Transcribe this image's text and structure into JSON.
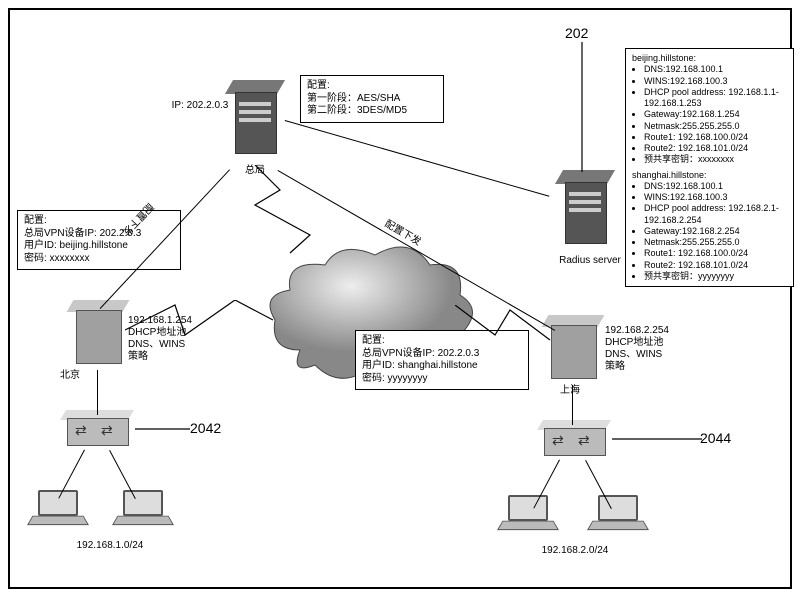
{
  "refs": {
    "r202": "202",
    "r2042": "2042",
    "r2044": "2044"
  },
  "hq": {
    "ip": "IP: 202.2.0.3",
    "name": "总局",
    "cfg_title": "配置:",
    "phase1": "第一阶段：AES/SHA",
    "phase2": "第二阶段：3DES/MD5"
  },
  "radius": {
    "name": "Radius server",
    "bj_header": "beijing.hillstone:",
    "bj": {
      "dns": "DNS:192.168.100.1",
      "wins": "WINS:192.168.100.3",
      "pool": "DHCP pool address: 192.168.1.1-192.168.1.253",
      "gw": "Gateway:192.168.1.254",
      "mask": "Netmask:255.255.255.0",
      "r1": "Route1: 192.168.100.0/24",
      "r2": "Route2: 192.168.101.0/24",
      "psk": "预共享密钥：xxxxxxxx"
    },
    "sh_header": "shanghai.hillstone:",
    "sh": {
      "dns": "DNS:192.168.100.1",
      "wins": "WINS:192.168.100.3",
      "pool": "DHCP pool address: 192.168.2.1-192.168.2.254",
      "gw": "Gateway:192.168.2.254",
      "mask": "Netmask:255.255.255.0",
      "r1": "Route1: 192.168.100.0/24",
      "r2": "Route2: 192.168.101.0/24",
      "psk": "预共享密钥：yyyyyyyy"
    }
  },
  "bj": {
    "name": "北京",
    "cfg_title": "配置:",
    "vpnip": "总局VPN设备IP: 202.2.0.3",
    "user": "用户ID: beijing.hillstone",
    "pass": "密码: xxxxxxxx",
    "info1": "192.168.1.254",
    "info2": "DHCP地址池",
    "info3": "DNS、WINS",
    "info4": "策略",
    "subnet": "192.168.1.0/24"
  },
  "sh": {
    "name": "上海",
    "cfg_title": "配置:",
    "vpnip": "总局VPN设备IP: 202.2.0.3",
    "user": "用户ID: shanghai.hillstone",
    "pass": "密码: yyyyyyyy",
    "info1": "192.168.2.254",
    "info2": "DHCP地址池",
    "info3": "DNS、WINS",
    "info4": "策略",
    "subnet": "192.168.2.0/24"
  },
  "edge": {
    "push": "配置下发"
  }
}
